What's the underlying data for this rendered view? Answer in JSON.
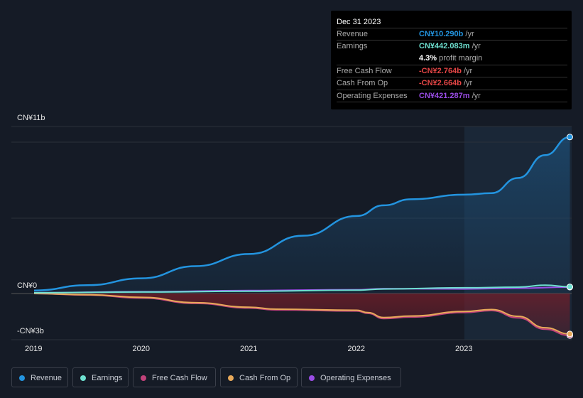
{
  "chart_data": {
    "type": "area",
    "yaxis": {
      "labels": [
        "CN¥11b",
        "CN¥0",
        "-CN¥3b"
      ],
      "ylim": [
        -3,
        11
      ]
    },
    "x_ticks": [
      "2019",
      "2020",
      "2021",
      "2022",
      "2023"
    ],
    "xlim": [
      2018.79,
      2024.0
    ],
    "series": [
      {
        "name": "Revenue",
        "color": "#2394df",
        "x": [
          2019,
          2019.5,
          2020,
          2020.5,
          2021,
          2021.5,
          2022,
          2022.25,
          2022.5,
          2023,
          2023.25,
          2023.5,
          2023.75,
          2023.98
        ],
        "values": [
          0.2,
          0.55,
          1.0,
          1.8,
          2.6,
          3.8,
          5.1,
          5.8,
          6.2,
          6.5,
          6.6,
          7.6,
          9.1,
          10.29
        ]
      },
      {
        "name": "Earnings",
        "color": "#6ee0d0",
        "x": [
          2019,
          2020,
          2021,
          2022,
          2022.25,
          2023,
          2023.5,
          2023.75,
          2023.98
        ],
        "values": [
          0.05,
          0.1,
          0.15,
          0.22,
          0.3,
          0.38,
          0.42,
          0.55,
          0.44
        ]
      },
      {
        "name": "Free Cash Flow",
        "color": "#c0427a",
        "x": [
          2019,
          2019.5,
          2020,
          2020.5,
          2021,
          2021.25,
          2022,
          2022.1,
          2022.25,
          2022.5,
          2023,
          2023.25,
          2023.5,
          2023.75,
          2023.98
        ],
        "values": [
          0,
          -0.1,
          -0.3,
          -0.65,
          -0.95,
          -1.08,
          -1.15,
          -1.3,
          -1.65,
          -1.55,
          -1.25,
          -1.12,
          -1.6,
          -2.35,
          -2.76
        ]
      },
      {
        "name": "Cash From Op",
        "color": "#e8a95a",
        "x": [
          2019,
          2019.5,
          2020,
          2020.5,
          2021,
          2021.25,
          2022,
          2022.1,
          2022.25,
          2022.5,
          2023,
          2023.25,
          2023.5,
          2023.75,
          2023.98
        ],
        "values": [
          0,
          -0.08,
          -0.25,
          -0.6,
          -0.9,
          -1.03,
          -1.1,
          -1.25,
          -1.58,
          -1.48,
          -1.18,
          -1.05,
          -1.5,
          -2.25,
          -2.66
        ]
      },
      {
        "name": "Operating Expenses",
        "color": "#9a4de6",
        "x": [
          2019,
          2020,
          2021,
          2022,
          2022.25,
          2023,
          2023.5,
          2023.98
        ],
        "values": [
          0.05,
          0.12,
          0.2,
          0.25,
          0.32,
          0.3,
          0.35,
          0.42
        ]
      }
    ],
    "highlight_from": 2023
  },
  "tooltip": {
    "date": "Dec 31 2023",
    "rows": [
      {
        "label": "Revenue",
        "value": "CN¥10.290b",
        "unit": " /yr",
        "color": "#2394df"
      },
      {
        "label": "Earnings",
        "value": "CN¥442.083m",
        "unit": " /yr",
        "color": "#6ee0d0"
      },
      {
        "label": "",
        "value": "4.3%",
        "unit": " profit margin",
        "color": "#ffffff"
      },
      {
        "label": "Free Cash Flow",
        "value": "-CN¥2.764b",
        "unit": " /yr",
        "color": "#e64646"
      },
      {
        "label": "Cash From Op",
        "value": "-CN¥2.664b",
        "unit": " /yr",
        "color": "#e64646"
      },
      {
        "label": "Operating Expenses",
        "value": "CN¥421.287m",
        "unit": " /yr",
        "color": "#9a4de6"
      }
    ]
  },
  "legend": [
    {
      "label": "Revenue",
      "color": "#2394df"
    },
    {
      "label": "Earnings",
      "color": "#6ee0d0"
    },
    {
      "label": "Free Cash Flow",
      "color": "#c0427a"
    },
    {
      "label": "Cash From Op",
      "color": "#e8a95a"
    },
    {
      "label": "Operating Expenses",
      "color": "#9a4de6"
    }
  ]
}
